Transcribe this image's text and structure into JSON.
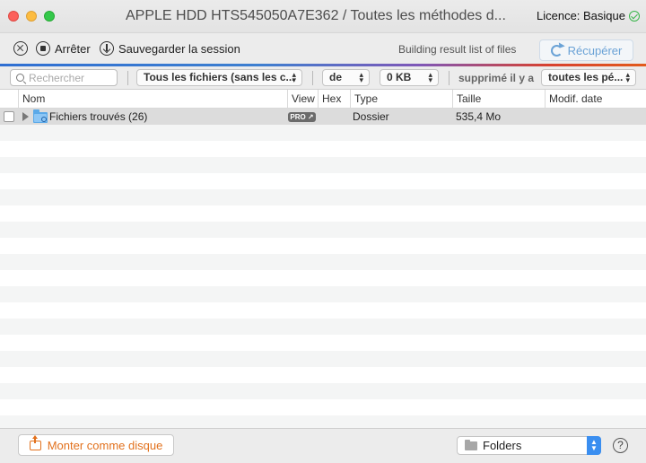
{
  "window": {
    "title": "APPLE HDD HTS545050A7E362 / Toutes les méthodes d...",
    "licence": "Licence: Basique"
  },
  "toolbar": {
    "stop_label": "Arrêter",
    "save_session_label": "Sauvegarder la session",
    "status_text": "Building result list of files",
    "recover_label": "Récupérer"
  },
  "filters": {
    "search_placeholder": "Rechercher",
    "file_type": "Tous les fichiers (sans les c...",
    "from_label": "de",
    "size": "0 KB",
    "deleted_label": "supprimé il y a",
    "period": "toutes les pé..."
  },
  "table": {
    "columns": [
      "Nom",
      "View",
      "Hex",
      "Type",
      "Taille",
      "Modif. date"
    ],
    "rows": [
      {
        "name": "Fichiers trouvés (26)",
        "view": "PRO ↗",
        "hex": "",
        "type": "Dossier",
        "size": "535,4 Mo",
        "modified": ""
      }
    ]
  },
  "footer": {
    "mount_label": "Monter comme disque",
    "view_mode": "Folders",
    "help": "?"
  },
  "colors": {
    "accent_blue": "#3a8ef0",
    "mount_orange": "#e2711d",
    "recover_blue": "#6aa2d6",
    "licence_green": "#39b54a"
  }
}
